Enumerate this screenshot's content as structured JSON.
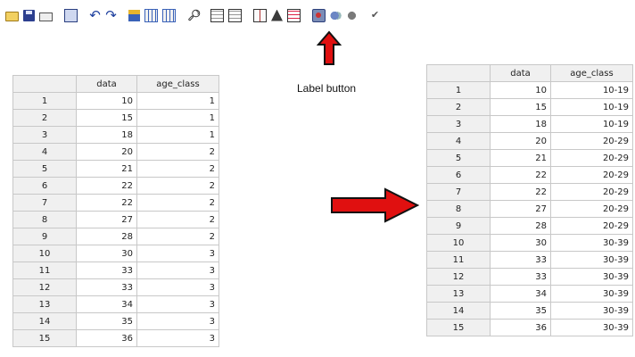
{
  "toolbar": {
    "icons": [
      "open-icon",
      "save-icon",
      "print-icon",
      "dialog-recall-icon",
      "undo-icon",
      "redo-icon",
      "goto-case-icon",
      "variables-icon",
      "find-icon",
      "insert-cases-icon",
      "insert-variable-icon",
      "split-file-icon",
      "weight-cases-icon",
      "select-cases-icon",
      "value-labels-icon",
      "use-sets-icon",
      "show-all-icon",
      "spelling-icon"
    ]
  },
  "annotation": {
    "label_button_text": "Label button"
  },
  "colors": {
    "arrow": "#e01010",
    "arrow_outline": "#111111",
    "grid_header": "#f0f0f0",
    "grid_border": "#c8c8c8"
  },
  "left_table": {
    "columns": [
      "",
      "data",
      "age_class"
    ],
    "rows": [
      [
        "1",
        "10",
        "1"
      ],
      [
        "2",
        "15",
        "1"
      ],
      [
        "3",
        "18",
        "1"
      ],
      [
        "4",
        "20",
        "2"
      ],
      [
        "5",
        "21",
        "2"
      ],
      [
        "6",
        "22",
        "2"
      ],
      [
        "7",
        "22",
        "2"
      ],
      [
        "8",
        "27",
        "2"
      ],
      [
        "9",
        "28",
        "2"
      ],
      [
        "10",
        "30",
        "3"
      ],
      [
        "11",
        "33",
        "3"
      ],
      [
        "12",
        "33",
        "3"
      ],
      [
        "13",
        "34",
        "3"
      ],
      [
        "14",
        "35",
        "3"
      ],
      [
        "15",
        "36",
        "3"
      ]
    ]
  },
  "right_table": {
    "columns": [
      "",
      "data",
      "age_class"
    ],
    "rows": [
      [
        "1",
        "10",
        "10-19"
      ],
      [
        "2",
        "15",
        "10-19"
      ],
      [
        "3",
        "18",
        "10-19"
      ],
      [
        "4",
        "20",
        "20-29"
      ],
      [
        "5",
        "21",
        "20-29"
      ],
      [
        "6",
        "22",
        "20-29"
      ],
      [
        "7",
        "22",
        "20-29"
      ],
      [
        "8",
        "27",
        "20-29"
      ],
      [
        "9",
        "28",
        "20-29"
      ],
      [
        "10",
        "30",
        "30-39"
      ],
      [
        "11",
        "33",
        "30-39"
      ],
      [
        "12",
        "33",
        "30-39"
      ],
      [
        "13",
        "34",
        "30-39"
      ],
      [
        "14",
        "35",
        "30-39"
      ],
      [
        "15",
        "36",
        "30-39"
      ]
    ]
  }
}
